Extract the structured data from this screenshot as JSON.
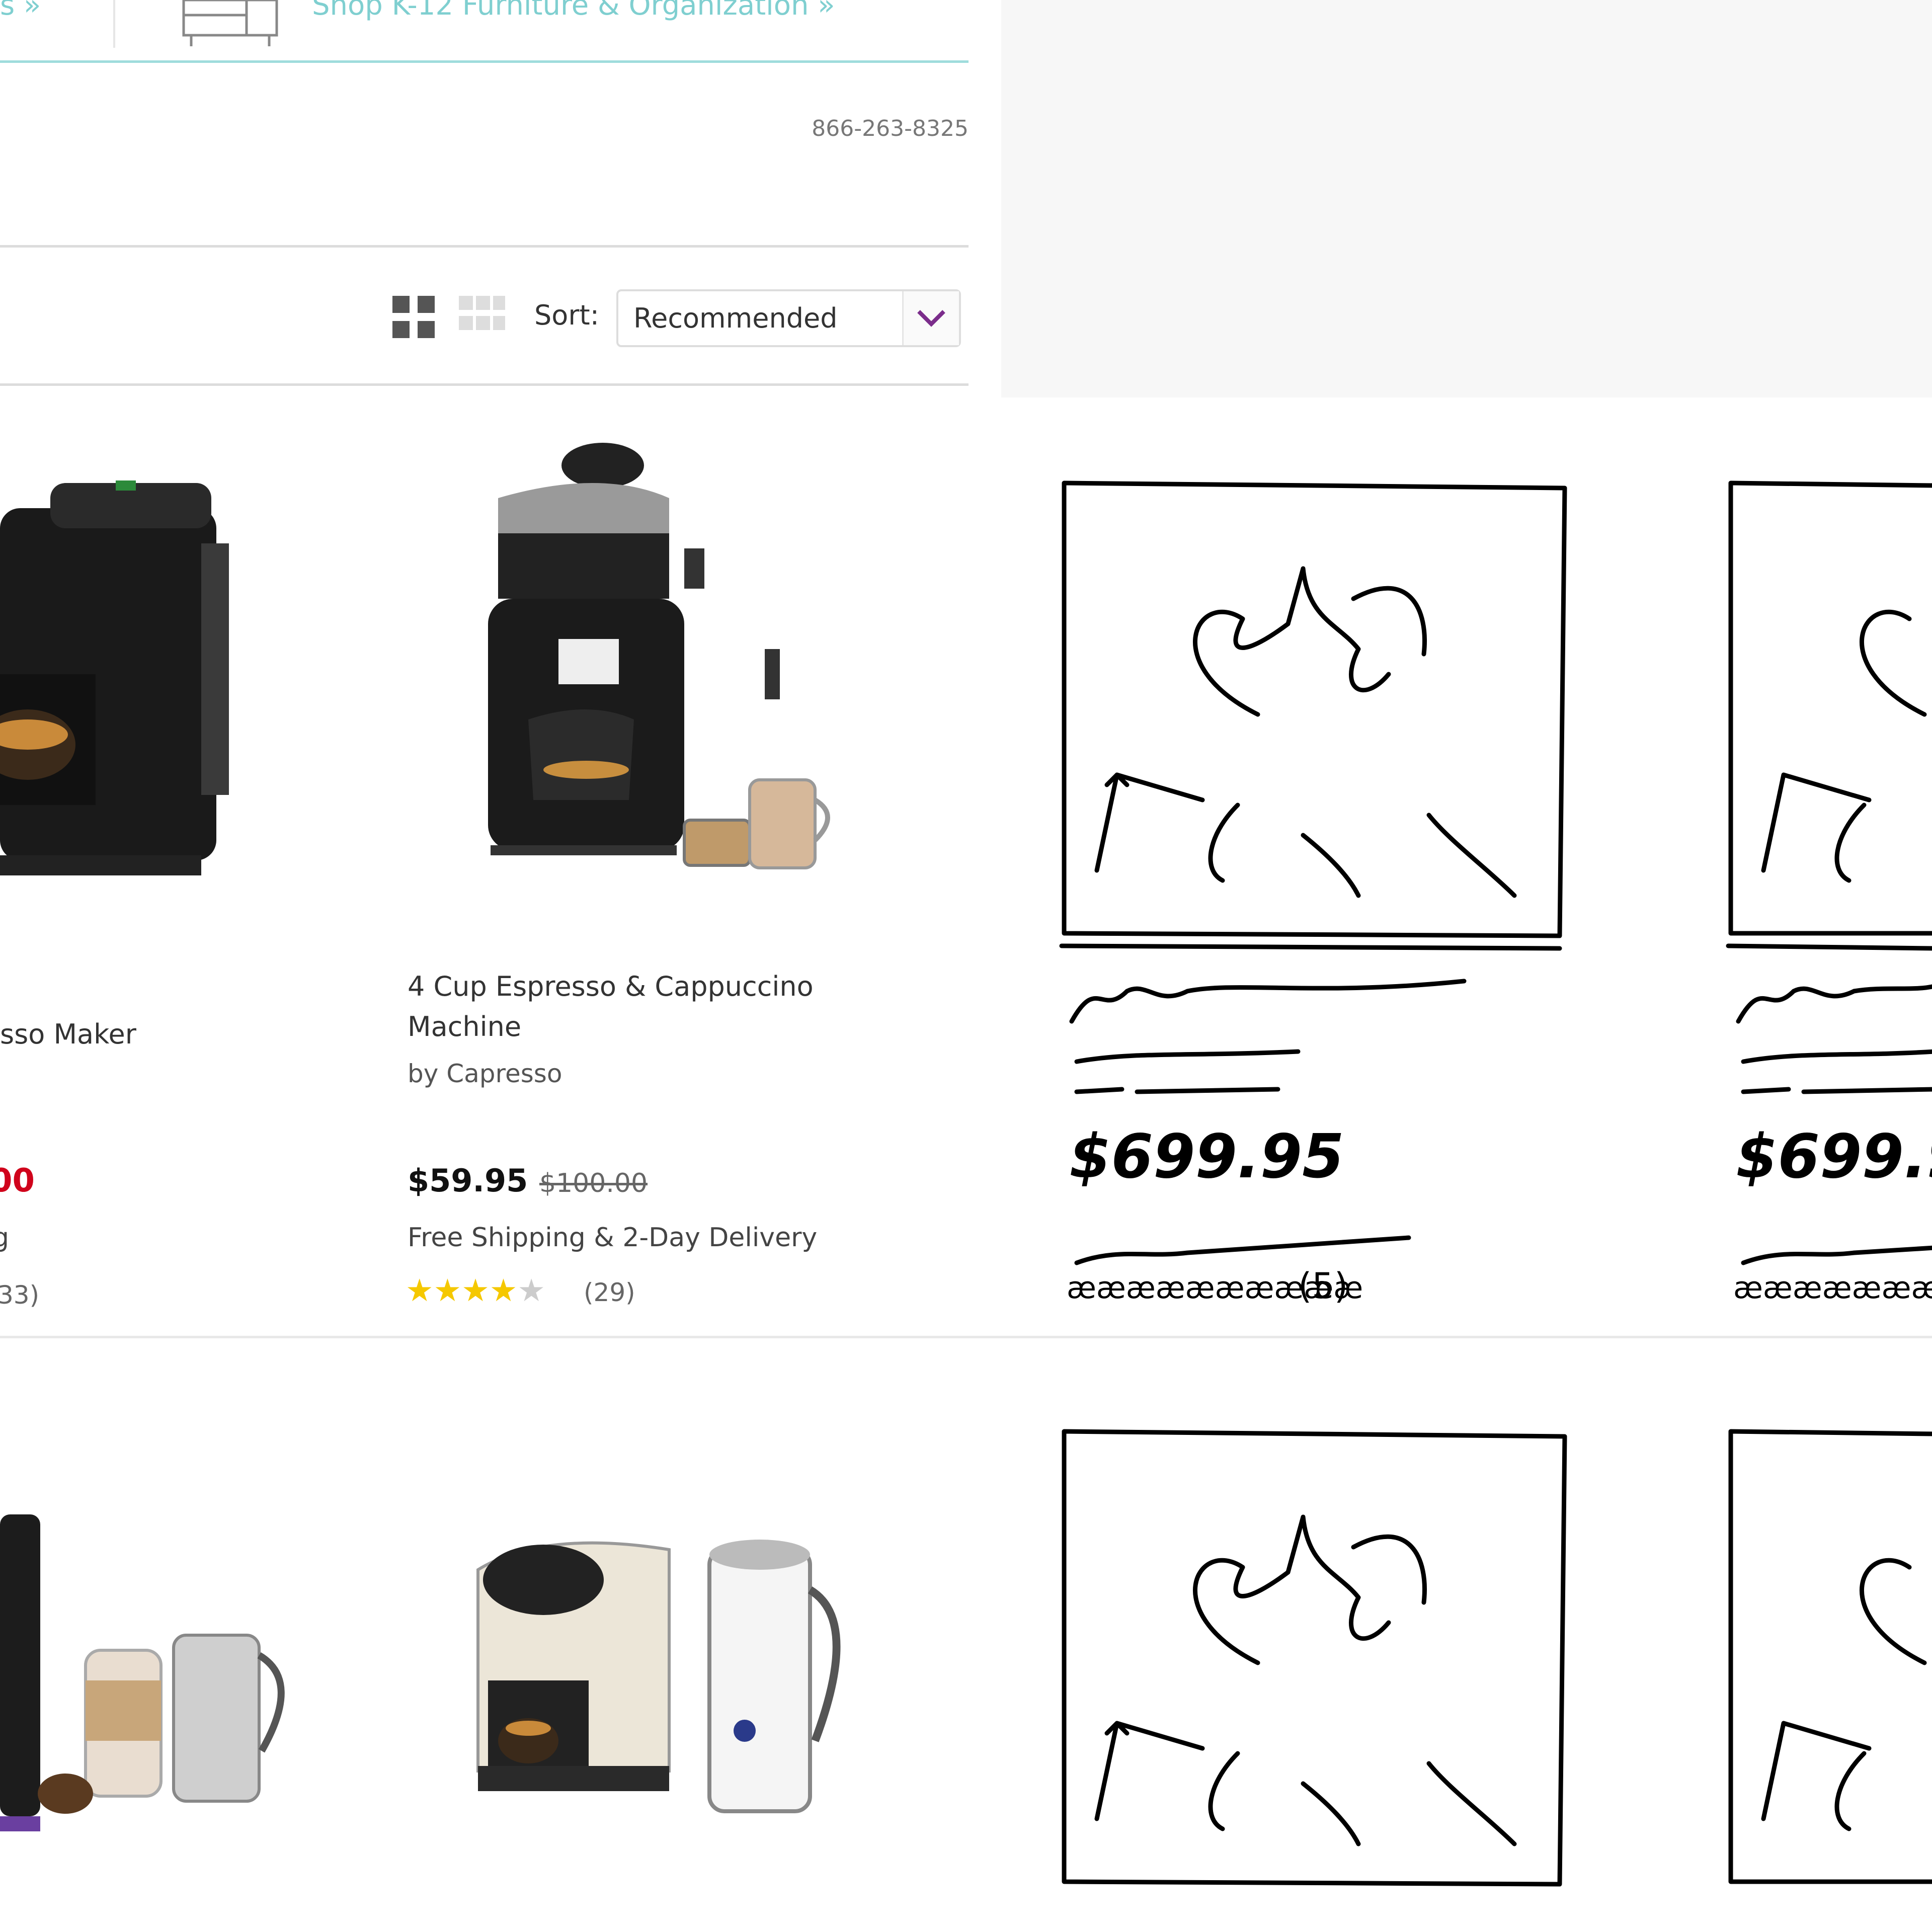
{
  "header": {
    "promo_left": "s »",
    "promo_main": "Shop K-12 Furniture & Organization »",
    "phone": "866-263-8325"
  },
  "toolbar": {
    "sort_label": "Sort:",
    "sort_value": "Recommended"
  },
  "products": [
    {
      "title_fragment": "sso Maker",
      "price_fragment": "00",
      "shipping_fragment": "g",
      "reviews_fragment": "33)"
    },
    {
      "title_line1": "4 Cup Espresso & Cappuccino",
      "title_line2": "Machine",
      "brand": "by Capresso",
      "price": "$59.95",
      "was_price": "$100.00",
      "shipping": "Free Shipping & 2-Day Delivery",
      "rating": 4,
      "reviews": "(29)"
    }
  ],
  "sketch": {
    "price": "$699.95",
    "reviews": "(5)"
  },
  "colors": {
    "accent": "#7fcfd0",
    "sale_red": "#d0021b",
    "star": "#f5c800",
    "chevron": "#7b2d8b"
  }
}
